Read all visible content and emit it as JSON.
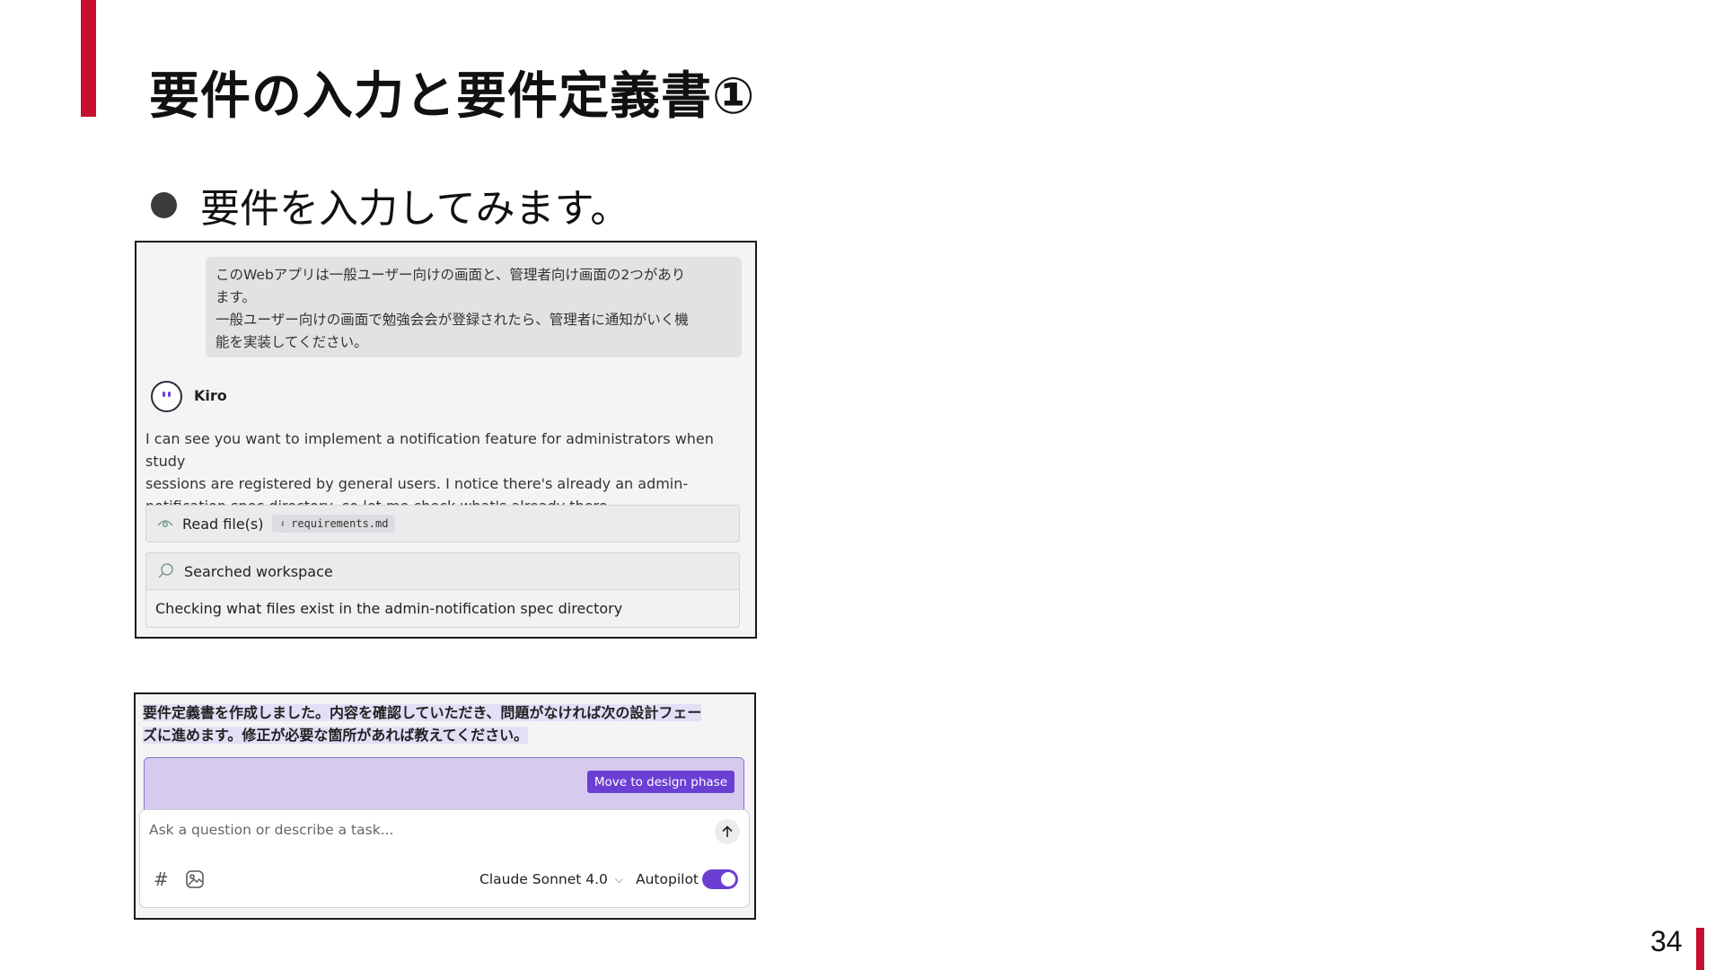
{
  "slide": {
    "title": "要件の入力と要件定義書①",
    "bullet": "要件を入力してみます。",
    "page_number": "34",
    "accent_color": "#c8102e"
  },
  "chat": {
    "user_message": [
      "このWebアプリは一般ユーザー向けの画面と、管理者向け画面の2つがあり",
      "ます。",
      "一般ユーザー向けの画面で勉強会会が登録されたら、管理者に通知がいく機",
      "能を実装してください。"
    ],
    "assistant_name": "Kiro",
    "assistant_message": [
      "I can see you want to implement a notification feature for administrators when study",
      "sessions are registered by general users. I notice there's already an admin-",
      "notification spec directory, so let me check what's already there."
    ],
    "read_tool": {
      "label": "Read file(s)",
      "file": "requirements.md",
      "icon": "eye-icon"
    },
    "search_tool": {
      "label": "Searched workspace",
      "detail": "Checking what files exist in the admin-notification spec directory",
      "icon": "search-icon"
    }
  },
  "completion": {
    "message_lines": [
      "要件定義書を作成しました。内容を確認していただき、問題がなければ次の設計フェー",
      "ズに進めます。修正が必要な箇所があれば教えてください。"
    ],
    "move_button": "Move to design phase",
    "input_placeholder": "Ask a question or describe a task...",
    "model": "Claude Sonnet 4.0",
    "autopilot_label": "Autopilot",
    "autopilot_on": true,
    "brand_color": "#6b3fd4"
  }
}
